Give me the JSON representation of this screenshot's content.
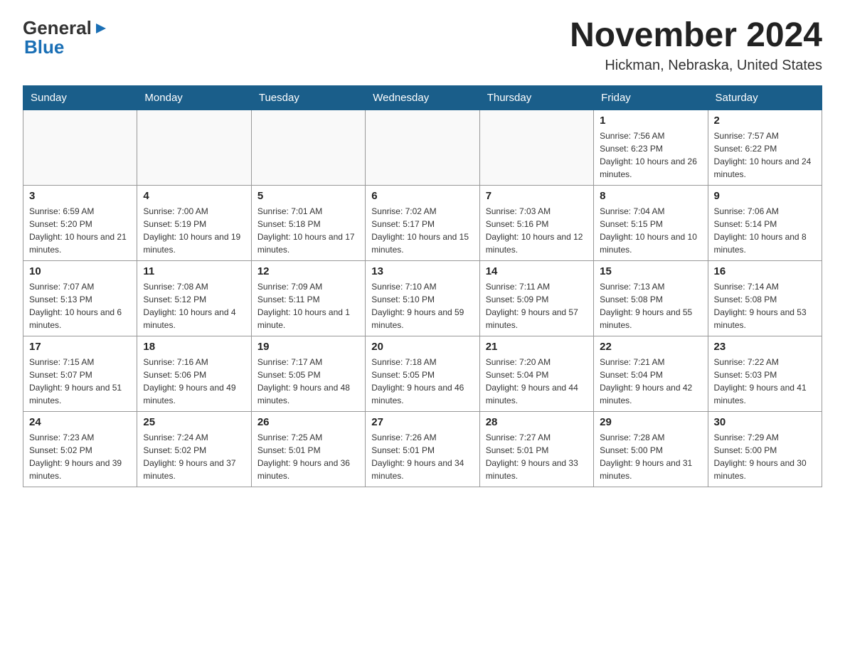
{
  "logo": {
    "general": "General",
    "blue": "Blue"
  },
  "title": "November 2024",
  "subtitle": "Hickman, Nebraska, United States",
  "weekdays": [
    "Sunday",
    "Monday",
    "Tuesday",
    "Wednesday",
    "Thursday",
    "Friday",
    "Saturday"
  ],
  "weeks": [
    [
      {
        "day": "",
        "info": ""
      },
      {
        "day": "",
        "info": ""
      },
      {
        "day": "",
        "info": ""
      },
      {
        "day": "",
        "info": ""
      },
      {
        "day": "",
        "info": ""
      },
      {
        "day": "1",
        "info": "Sunrise: 7:56 AM\nSunset: 6:23 PM\nDaylight: 10 hours and 26 minutes."
      },
      {
        "day": "2",
        "info": "Sunrise: 7:57 AM\nSunset: 6:22 PM\nDaylight: 10 hours and 24 minutes."
      }
    ],
    [
      {
        "day": "3",
        "info": "Sunrise: 6:59 AM\nSunset: 5:20 PM\nDaylight: 10 hours and 21 minutes."
      },
      {
        "day": "4",
        "info": "Sunrise: 7:00 AM\nSunset: 5:19 PM\nDaylight: 10 hours and 19 minutes."
      },
      {
        "day": "5",
        "info": "Sunrise: 7:01 AM\nSunset: 5:18 PM\nDaylight: 10 hours and 17 minutes."
      },
      {
        "day": "6",
        "info": "Sunrise: 7:02 AM\nSunset: 5:17 PM\nDaylight: 10 hours and 15 minutes."
      },
      {
        "day": "7",
        "info": "Sunrise: 7:03 AM\nSunset: 5:16 PM\nDaylight: 10 hours and 12 minutes."
      },
      {
        "day": "8",
        "info": "Sunrise: 7:04 AM\nSunset: 5:15 PM\nDaylight: 10 hours and 10 minutes."
      },
      {
        "day": "9",
        "info": "Sunrise: 7:06 AM\nSunset: 5:14 PM\nDaylight: 10 hours and 8 minutes."
      }
    ],
    [
      {
        "day": "10",
        "info": "Sunrise: 7:07 AM\nSunset: 5:13 PM\nDaylight: 10 hours and 6 minutes."
      },
      {
        "day": "11",
        "info": "Sunrise: 7:08 AM\nSunset: 5:12 PM\nDaylight: 10 hours and 4 minutes."
      },
      {
        "day": "12",
        "info": "Sunrise: 7:09 AM\nSunset: 5:11 PM\nDaylight: 10 hours and 1 minute."
      },
      {
        "day": "13",
        "info": "Sunrise: 7:10 AM\nSunset: 5:10 PM\nDaylight: 9 hours and 59 minutes."
      },
      {
        "day": "14",
        "info": "Sunrise: 7:11 AM\nSunset: 5:09 PM\nDaylight: 9 hours and 57 minutes."
      },
      {
        "day": "15",
        "info": "Sunrise: 7:13 AM\nSunset: 5:08 PM\nDaylight: 9 hours and 55 minutes."
      },
      {
        "day": "16",
        "info": "Sunrise: 7:14 AM\nSunset: 5:08 PM\nDaylight: 9 hours and 53 minutes."
      }
    ],
    [
      {
        "day": "17",
        "info": "Sunrise: 7:15 AM\nSunset: 5:07 PM\nDaylight: 9 hours and 51 minutes."
      },
      {
        "day": "18",
        "info": "Sunrise: 7:16 AM\nSunset: 5:06 PM\nDaylight: 9 hours and 49 minutes."
      },
      {
        "day": "19",
        "info": "Sunrise: 7:17 AM\nSunset: 5:05 PM\nDaylight: 9 hours and 48 minutes."
      },
      {
        "day": "20",
        "info": "Sunrise: 7:18 AM\nSunset: 5:05 PM\nDaylight: 9 hours and 46 minutes."
      },
      {
        "day": "21",
        "info": "Sunrise: 7:20 AM\nSunset: 5:04 PM\nDaylight: 9 hours and 44 minutes."
      },
      {
        "day": "22",
        "info": "Sunrise: 7:21 AM\nSunset: 5:04 PM\nDaylight: 9 hours and 42 minutes."
      },
      {
        "day": "23",
        "info": "Sunrise: 7:22 AM\nSunset: 5:03 PM\nDaylight: 9 hours and 41 minutes."
      }
    ],
    [
      {
        "day": "24",
        "info": "Sunrise: 7:23 AM\nSunset: 5:02 PM\nDaylight: 9 hours and 39 minutes."
      },
      {
        "day": "25",
        "info": "Sunrise: 7:24 AM\nSunset: 5:02 PM\nDaylight: 9 hours and 37 minutes."
      },
      {
        "day": "26",
        "info": "Sunrise: 7:25 AM\nSunset: 5:01 PM\nDaylight: 9 hours and 36 minutes."
      },
      {
        "day": "27",
        "info": "Sunrise: 7:26 AM\nSunset: 5:01 PM\nDaylight: 9 hours and 34 minutes."
      },
      {
        "day": "28",
        "info": "Sunrise: 7:27 AM\nSunset: 5:01 PM\nDaylight: 9 hours and 33 minutes."
      },
      {
        "day": "29",
        "info": "Sunrise: 7:28 AM\nSunset: 5:00 PM\nDaylight: 9 hours and 31 minutes."
      },
      {
        "day": "30",
        "info": "Sunrise: 7:29 AM\nSunset: 5:00 PM\nDaylight: 9 hours and 30 minutes."
      }
    ]
  ]
}
